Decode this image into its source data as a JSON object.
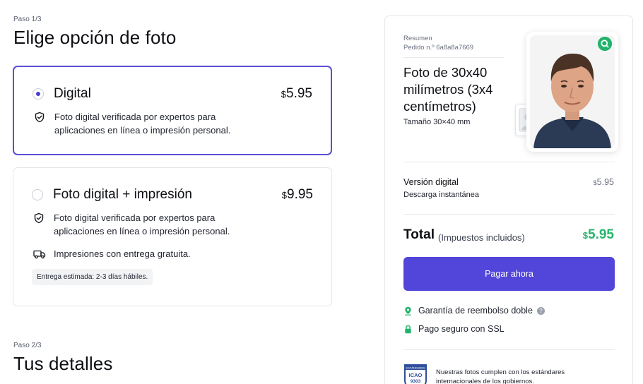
{
  "step1": {
    "label": "Paso 1/3",
    "title": "Elige opción de foto"
  },
  "options": [
    {
      "title": "Digital",
      "currency": "$",
      "price": "5.95",
      "selected": true,
      "features": [
        {
          "icon": "shield-check-icon",
          "text": "Foto digital verificada por expertos para aplicaciones en línea o impresión personal."
        }
      ]
    },
    {
      "title": "Foto digital + impresión",
      "currency": "$",
      "price": "9.95",
      "selected": false,
      "features": [
        {
          "icon": "shield-check-icon",
          "text": "Foto digital verificada por expertos para aplicaciones en línea o impresión personal."
        },
        {
          "icon": "truck-icon",
          "text": "Impresiones con entrega gratuita."
        }
      ],
      "delivery_note": "Entrega estimada: 2-3 días hábiles."
    }
  ],
  "step2": {
    "label": "Paso 2/3",
    "title": "Tus detalles"
  },
  "summary": {
    "heading": "Resumen",
    "order": "Pedido n.º 6a8a8a7669",
    "product_title": "Foto de 30x40 milímetros (3x4 centímetros)",
    "product_size": "Tamaño 30×40 mm",
    "line_item": {
      "name": "Versión digital",
      "description": "Descarga instantánea",
      "currency": "$",
      "price": "5.95"
    },
    "total": {
      "label": "Total",
      "note": "(Impuestos incluidos)",
      "currency": "$",
      "price": "5.95"
    },
    "pay_button": "Pagar ahora",
    "guarantees": [
      {
        "icon": "location-pin-icon",
        "text": "Garantía de reembolso doble",
        "help": "?"
      },
      {
        "icon": "lock-icon",
        "text": "Pago seguro con SSL"
      }
    ],
    "icao_badge": {
      "line1": "ESTÁNDARES",
      "line2": "ICAO",
      "line3": "9303"
    },
    "icao_text": "Nuestras fotos cumplen con los estándares internacionales de los gobiernos."
  },
  "colors": {
    "accent": "#5146d9",
    "selected_border": "#5b4fd6",
    "total_green": "#27b56e",
    "badge_green": "#21b36b"
  }
}
